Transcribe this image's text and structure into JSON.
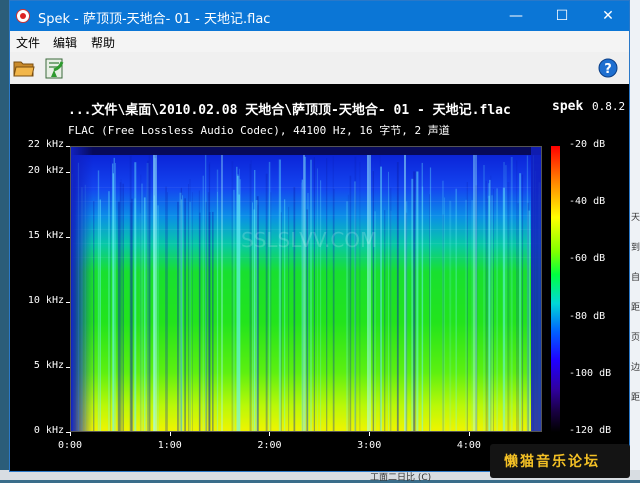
{
  "window": {
    "title": "Spek - 萨顶顶-天地合- 01 - 天地记.flac",
    "controls": {
      "minimize": "—",
      "maximize": "☐",
      "close": "✕"
    }
  },
  "menu": [
    {
      "label": "文件"
    },
    {
      "label": "编辑"
    },
    {
      "label": "帮助"
    }
  ],
  "toolbar": {
    "open_icon": "folder-open-icon",
    "save_icon": "save-export-icon",
    "help_icon": "help-icon"
  },
  "spectrogram": {
    "file_path": "...文件\\桌面\\2010.02.08 天地合\\萨顶顶-天地合- 01 - 天地记.flac",
    "app_name": "spek",
    "app_version": "0.8.2",
    "description": "FLAC (Free Lossless Audio Codec), 44100 Hz, 16 字节, 2 声道",
    "y_axis_labels": [
      "22 kHz",
      "20 kHz",
      "15 kHz",
      "10 kHz",
      "5 kHz",
      "0 kHz"
    ],
    "y_axis_values_khz": [
      22,
      20,
      15,
      10,
      5,
      0
    ],
    "x_axis_labels": [
      "0:00",
      "1:00",
      "2:00",
      "3:00",
      "4:00"
    ],
    "x_axis_values_sec": [
      0,
      60,
      120,
      180,
      240
    ],
    "duration_sec": 284,
    "db_labels": [
      "-20 dB",
      "-40 dB",
      "-60 dB",
      "-80 dB",
      "-100 dB",
      "-120 dB"
    ],
    "db_values": [
      -20,
      -40,
      -60,
      -80,
      -100,
      -120
    ],
    "watermark": "SSLSLVV.COM"
  },
  "desktop": {
    "right_glyphs": [
      "天",
      "到",
      "自",
      "距",
      "页",
      "边",
      "距"
    ],
    "bottom_text": "工面二日比 (C)"
  },
  "forum_watermark": "懒猫音乐论坛"
}
